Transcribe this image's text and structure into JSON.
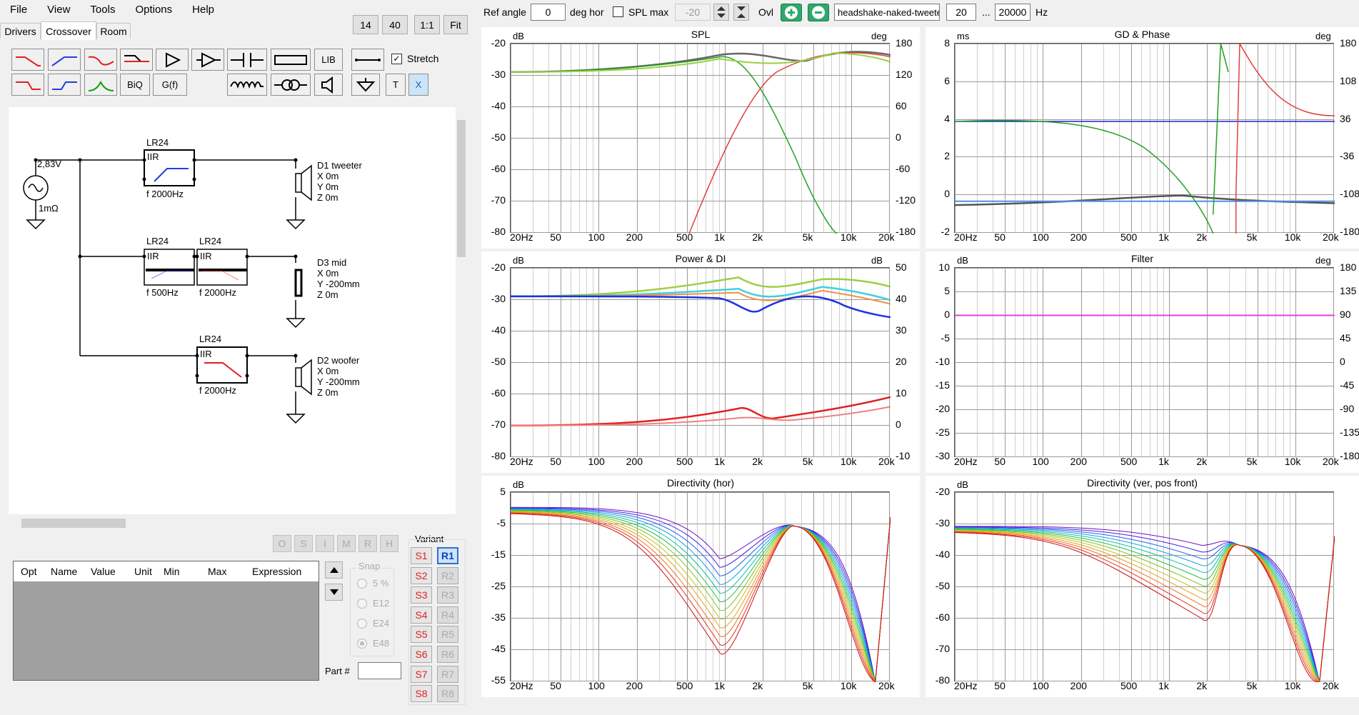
{
  "menu": [
    "File",
    "View",
    "Tools",
    "Options",
    "Help"
  ],
  "zoom_buttons": [
    "14",
    "40",
    "1:1",
    "Fit"
  ],
  "tabs": [
    "Drivers",
    "Crossover",
    "Room"
  ],
  "toolbar": {
    "lib_label": "LIB",
    "biq_label": "BiQ",
    "gf_label": "G(f)",
    "t_label": "T",
    "x_label": "X",
    "stretch_label": "Stretch",
    "stretch_checked": true
  },
  "schematic": {
    "source_voltage": "2,83V",
    "source_impedance": "1mΩ",
    "filters": [
      {
        "type": "LR24",
        "kind": "IIR",
        "freq": "f   2000Hz",
        "shape": "highpass"
      },
      {
        "type": "LR24",
        "kind": "IIR",
        "freq": "f   500Hz",
        "shape": "highpass"
      },
      {
        "type": "LR24",
        "kind": "IIR",
        "freq": "f   2000Hz",
        "shape": "lowpass"
      },
      {
        "type": "LR24",
        "kind": "IIR",
        "freq": "f   2000Hz",
        "shape": "lowpass"
      }
    ],
    "drivers": [
      {
        "name": "D1 tweeter",
        "x": "X 0m",
        "y": "Y 0m",
        "z": "Z 0m"
      },
      {
        "name": "D3 mid",
        "x": "X 0m",
        "y": "Y -200mm",
        "z": "Z 0m"
      },
      {
        "name": "D2 woofer",
        "x": "X 0m",
        "y": "Y -200mm",
        "z": "Z 0m"
      }
    ]
  },
  "opt_buttons": [
    "O",
    "S",
    "I",
    "M",
    "R",
    "H"
  ],
  "table": {
    "headers": [
      "Opt",
      "Name",
      "Value",
      "Unit",
      "Min",
      "Max",
      "Expression"
    ]
  },
  "snap": {
    "title": "Snap",
    "options": [
      "5 %",
      "E12",
      "E24",
      "E48"
    ],
    "selected": "E48"
  },
  "part_label": "Part #",
  "variant": {
    "title": "Variant",
    "s": [
      "S1",
      "S2",
      "S3",
      "S4",
      "S5",
      "S6",
      "S7",
      "S8"
    ],
    "r": [
      "R1",
      "R2",
      "R3",
      "R4",
      "R5",
      "R6",
      "R7",
      "R8"
    ],
    "active_r": "R1"
  },
  "topbar": {
    "ref_angle_label": "Ref angle",
    "ref_angle_value": "0",
    "deg_hor_label": "deg hor",
    "spl_max_label": "SPL max",
    "spl_max_value": "-20",
    "ovl_label": "Ovl",
    "preset_value": "headshake-naked-tweeter",
    "f_min": "20",
    "ellipsis": "...",
    "f_max": "20000",
    "hz": "Hz"
  },
  "x_ticks": [
    "20Hz",
    "50",
    "100",
    "200",
    "500",
    "1k",
    "2k",
    "5k",
    "10k",
    "20k"
  ],
  "charts": [
    {
      "title": "SPL",
      "left_unit": "dB",
      "right_unit": "deg",
      "left_ticks": [
        "-20",
        "-30",
        "-40",
        "-50",
        "-60",
        "-70",
        "-80"
      ],
      "right_ticks": [
        "180",
        "120",
        "60",
        "0",
        "-60",
        "-120",
        "-180"
      ]
    },
    {
      "title": "GD & Phase",
      "left_unit": "ms",
      "right_unit": "deg",
      "left_ticks": [
        "8",
        "6",
        "4",
        "2",
        "0",
        "-2"
      ],
      "right_ticks": [
        "180",
        "108",
        "36",
        "-36",
        "-108",
        "-180"
      ]
    },
    {
      "title": "Power & DI",
      "left_unit": "dB",
      "right_unit": "dB",
      "left_ticks": [
        "-20",
        "-30",
        "-40",
        "-50",
        "-60",
        "-70",
        "-80"
      ],
      "right_ticks": [
        "50",
        "40",
        "30",
        "20",
        "10",
        "0",
        "-10"
      ]
    },
    {
      "title": "Filter",
      "left_unit": "dB",
      "right_unit": "deg",
      "left_ticks": [
        "10",
        "5",
        "0",
        "-5",
        "-10",
        "-15",
        "-20",
        "-25",
        "-30"
      ],
      "right_ticks": [
        "180",
        "135",
        "90",
        "45",
        "0",
        "-45",
        "-90",
        "-135",
        "-180"
      ]
    },
    {
      "title": "Directivity (hor)",
      "left_unit": "dB",
      "right_unit": "",
      "left_ticks": [
        "5",
        "-5",
        "-15",
        "-25",
        "-35",
        "-45",
        "-55"
      ],
      "right_ticks": []
    },
    {
      "title": "Directivity (ver, pos front)",
      "left_unit": "dB",
      "right_unit": "",
      "left_ticks": [
        "-20",
        "-30",
        "-40",
        "-50",
        "-60",
        "-70",
        "-80"
      ],
      "right_ticks": []
    }
  ],
  "colors": {
    "accent_active": "#cce4f7",
    "red_text": "#e02020"
  }
}
